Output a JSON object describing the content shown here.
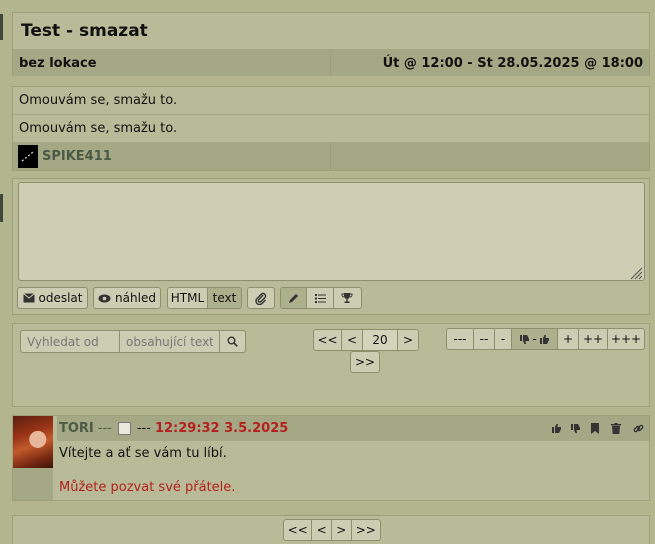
{
  "event": {
    "title": "Test - smazat",
    "location": "bez lokace",
    "datetime": "Út @ 12:00 - St 28.05.2025 @ 18:00",
    "line1": "Omouvám se, smažu to.",
    "line2": "Omouvám se, smažu to.",
    "author": "SPIKE411"
  },
  "editor": {
    "send_label": "odeslat",
    "preview_label": "náhled",
    "mode_html": "HTML",
    "mode_text": "text"
  },
  "search": {
    "from_placeholder": "Vyhledat od",
    "text_placeholder": "obsahující text"
  },
  "pager": {
    "first": "<<",
    "prev": "<",
    "page_size": "20",
    "next": ">",
    "last": ">>"
  },
  "rating": {
    "b1": "---",
    "b2": "--",
    "b3": "-",
    "b4": "-",
    "b5": "+",
    "b6": "++",
    "b7": "+++"
  },
  "post": {
    "author": "TORI",
    "sep1": "---",
    "sep2": "---",
    "timestamp": "12:29:32 3.5.2025",
    "message": "Vítejte a ať se vám tu líbí.",
    "note": "Můžete pozvat své přátele."
  },
  "bottom_pager": {
    "first": "<<",
    "prev": "<",
    "next": ">",
    "last": ">>"
  },
  "colors": {
    "background": "#b3b58f",
    "accent_red": "#b5201e",
    "name_green": "#4b5a44"
  }
}
